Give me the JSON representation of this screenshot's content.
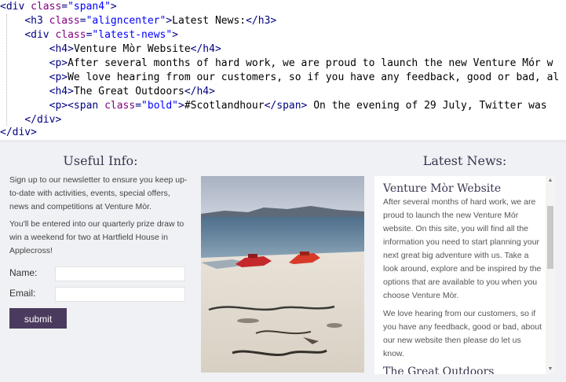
{
  "code": {
    "lines": [
      {
        "indent": "",
        "parts": [
          [
            "tag",
            "<div "
          ],
          [
            "attr",
            "class"
          ],
          [
            "tag",
            "="
          ],
          [
            "str",
            "\"span4\""
          ],
          [
            "tag",
            ">"
          ]
        ]
      },
      {
        "indent": "    ",
        "parts": [
          [
            "tag",
            "<h3 "
          ],
          [
            "attr",
            "class"
          ],
          [
            "tag",
            "="
          ],
          [
            "str",
            "\"aligncenter\""
          ],
          [
            "tag",
            ">"
          ],
          [
            "txt",
            "Latest News:"
          ],
          [
            "tag",
            "</h3>"
          ]
        ]
      },
      {
        "indent": "    ",
        "parts": [
          [
            "tag",
            "<div "
          ],
          [
            "attr",
            "class"
          ],
          [
            "tag",
            "="
          ],
          [
            "str",
            "\"latest-news\""
          ],
          [
            "tag",
            ">"
          ]
        ]
      },
      {
        "indent": "        ",
        "parts": [
          [
            "tag",
            "<h4>"
          ],
          [
            "txt",
            "Venture Mòr Website"
          ],
          [
            "tag",
            "</h4>"
          ]
        ]
      },
      {
        "indent": "        ",
        "parts": [
          [
            "tag",
            "<p>"
          ],
          [
            "txt",
            "After several months of hard work, we are proud to launch the new Venture Mór w"
          ]
        ]
      },
      {
        "indent": "        ",
        "parts": [
          [
            "tag",
            "<p>"
          ],
          [
            "txt",
            "We love hearing from our customers, so if you have any feedback, good or bad, al"
          ]
        ]
      },
      {
        "indent": "        ",
        "parts": [
          [
            "tag",
            "<h4>"
          ],
          [
            "txt",
            "The Great Outdoors"
          ],
          [
            "tag",
            "</h4>"
          ]
        ]
      },
      {
        "indent": "        ",
        "parts": [
          [
            "tag",
            "<p><span "
          ],
          [
            "attr",
            "class"
          ],
          [
            "tag",
            "="
          ],
          [
            "str",
            "\"bold\""
          ],
          [
            "tag",
            ">"
          ],
          [
            "txt",
            "#Scotlandhour"
          ],
          [
            "tag",
            "</span>"
          ],
          [
            "txt",
            " On the evening of 29 July, Twitter was "
          ]
        ]
      },
      {
        "indent": "    ",
        "parts": [
          [
            "tag",
            "</div>"
          ]
        ]
      },
      {
        "indent": "",
        "parts": [
          [
            "tag",
            "</div>"
          ]
        ]
      }
    ]
  },
  "useful_info": {
    "heading": "Useful Info:",
    "para1": "Sign up to our newsletter to ensure you keep up-to-date with activities, events, special offers, news and competitions at Venture Mòr.",
    "para2": "You'll be entered into our quarterly prize draw to win a weekend for two at Hartfield House in Applecross!",
    "name_label": "Name:",
    "email_label": "Email:",
    "name_value": "",
    "email_value": "",
    "submit_label": "submit"
  },
  "latest_news": {
    "heading": "Latest News:",
    "items": [
      {
        "title": "Venture Mòr Website",
        "paras": [
          "After several months of hard work, we are proud to launch the new Venture Mór website. On this site, you will find all the information you need to start planning your next great big adventure with us. Take a look around, explore and be inspired by the options that are available to you when you choose Venture Mòr.",
          "We love hearing from our customers, so if you have any feedback, good or bad, about our new website then please do let us know."
        ]
      },
      {
        "title": "The Great Outdoors",
        "paras": []
      }
    ]
  },
  "colors": {
    "button": "#4a3b5e",
    "heading": "#3a3650",
    "background": "#f0f1f4"
  }
}
